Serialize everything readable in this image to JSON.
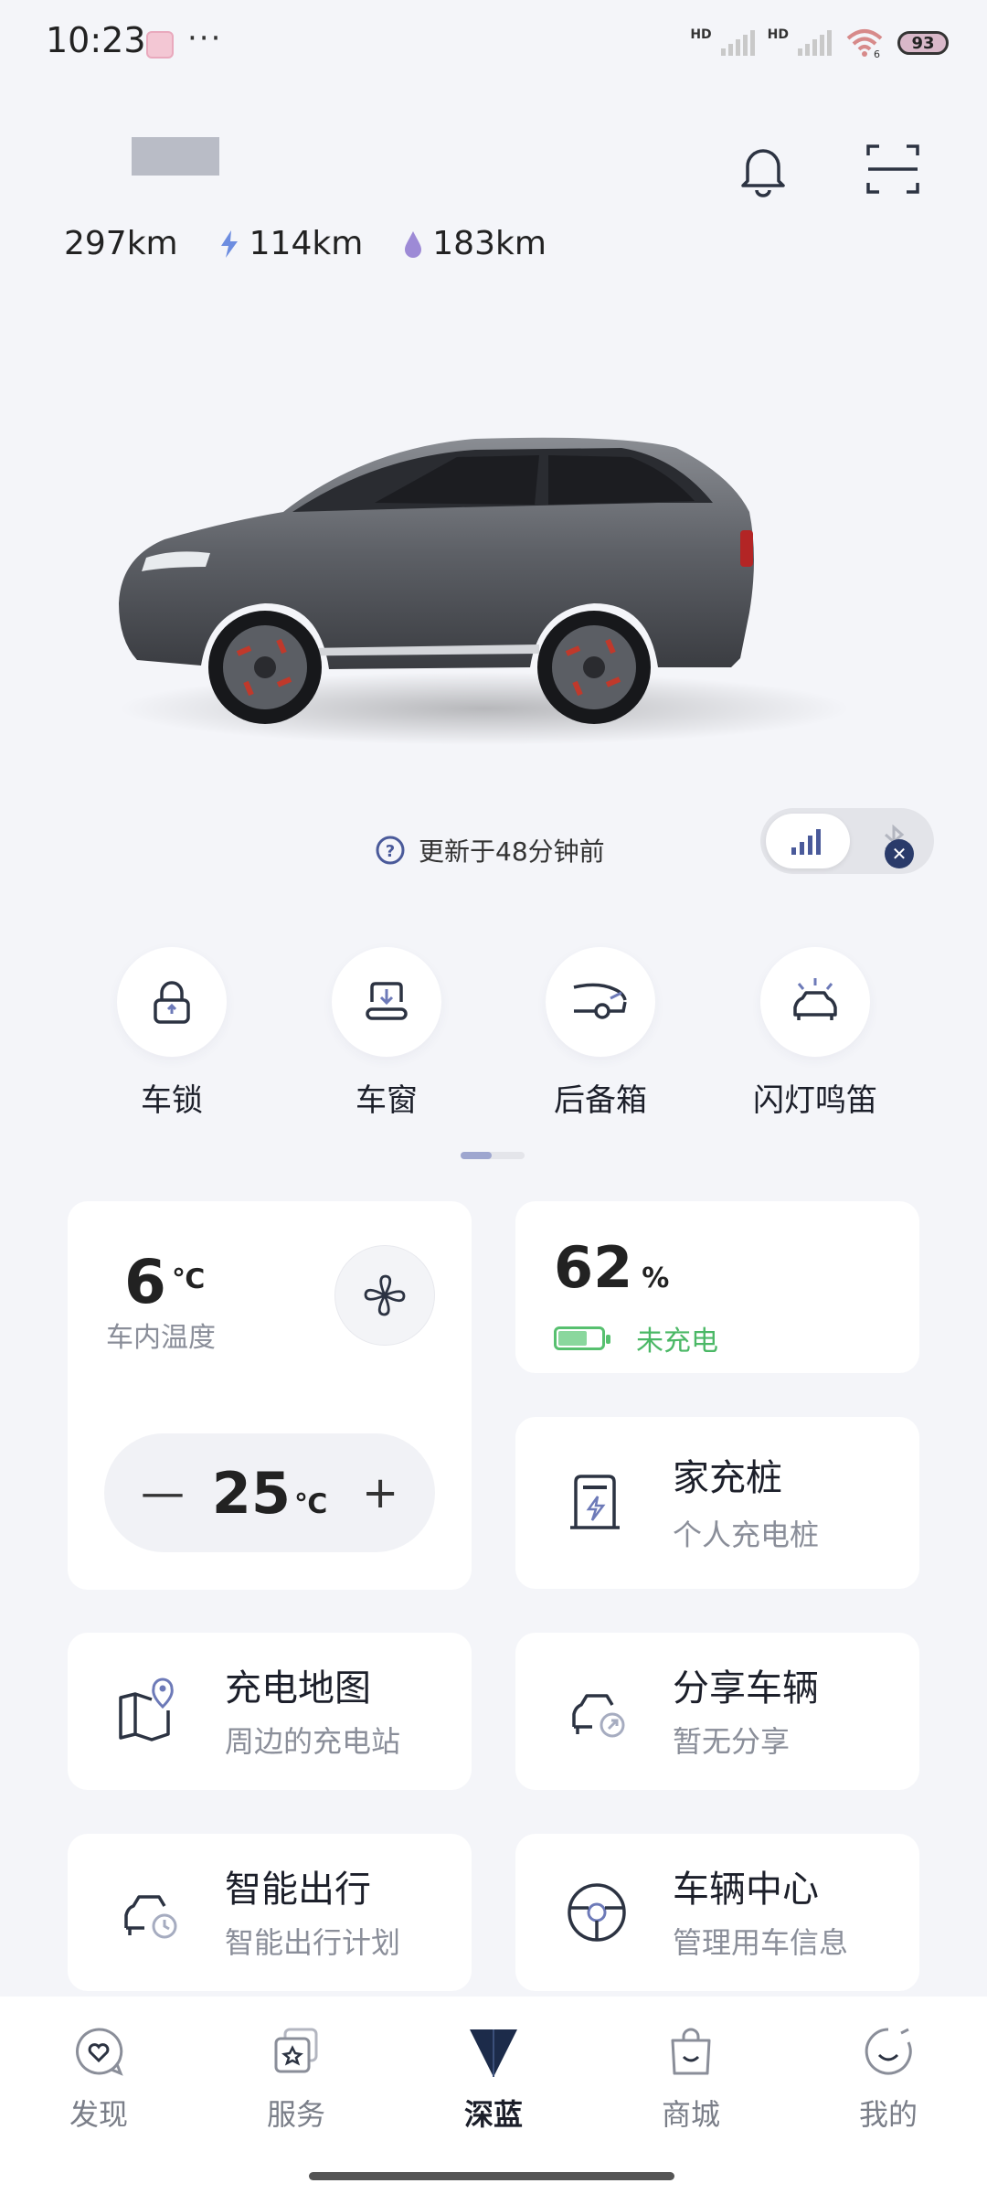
{
  "status_bar": {
    "time": "10:23",
    "more": "···",
    "hd": "HD",
    "wifi_level": "6",
    "battery": "93"
  },
  "header": {
    "bell_icon": "bell-icon",
    "scan_icon": "scan-icon"
  },
  "ranges": {
    "total": "297km",
    "electric": "114km",
    "fuel": "183km"
  },
  "update": {
    "text": "更新于48分钟前"
  },
  "quick_actions": [
    {
      "label": "车锁",
      "icon": "lock-icon"
    },
    {
      "label": "车窗",
      "icon": "window-icon"
    },
    {
      "label": "后备箱",
      "icon": "trunk-icon"
    },
    {
      "label": "闪灯鸣笛",
      "icon": "flash-horn-icon"
    }
  ],
  "climate": {
    "temp": "6",
    "temp_unit": "℃",
    "label": "车内温度",
    "set_temp": "25",
    "set_unit": "℃",
    "minus": "—",
    "plus": "+"
  },
  "battery_card": {
    "percent": "62",
    "unit": "%",
    "status": "未充电",
    "level": 0.62
  },
  "features": [
    {
      "title": "家充桩",
      "sub": "个人充电桩",
      "icon": "home-charger-icon"
    },
    {
      "title": "充电地图",
      "sub": "周边的充电站",
      "icon": "charging-map-icon"
    },
    {
      "title": "分享车辆",
      "sub": "暂无分享",
      "icon": "share-car-icon"
    },
    {
      "title": "智能出行",
      "sub": "智能出行计划",
      "icon": "smart-trip-icon"
    },
    {
      "title": "车辆中心",
      "sub": "管理用车信息",
      "icon": "steering-wheel-icon"
    }
  ],
  "nav": [
    {
      "label": "发现",
      "icon": "discover-icon"
    },
    {
      "label": "服务",
      "icon": "service-icon"
    },
    {
      "label": "深蓝",
      "icon": "deepal-logo-icon"
    },
    {
      "label": "商城",
      "icon": "shop-icon"
    },
    {
      "label": "我的",
      "icon": "profile-icon"
    }
  ],
  "colors": {
    "accent": "#1c2b4a",
    "charging_status": "#4bb866",
    "background": "#f4f5f9"
  }
}
